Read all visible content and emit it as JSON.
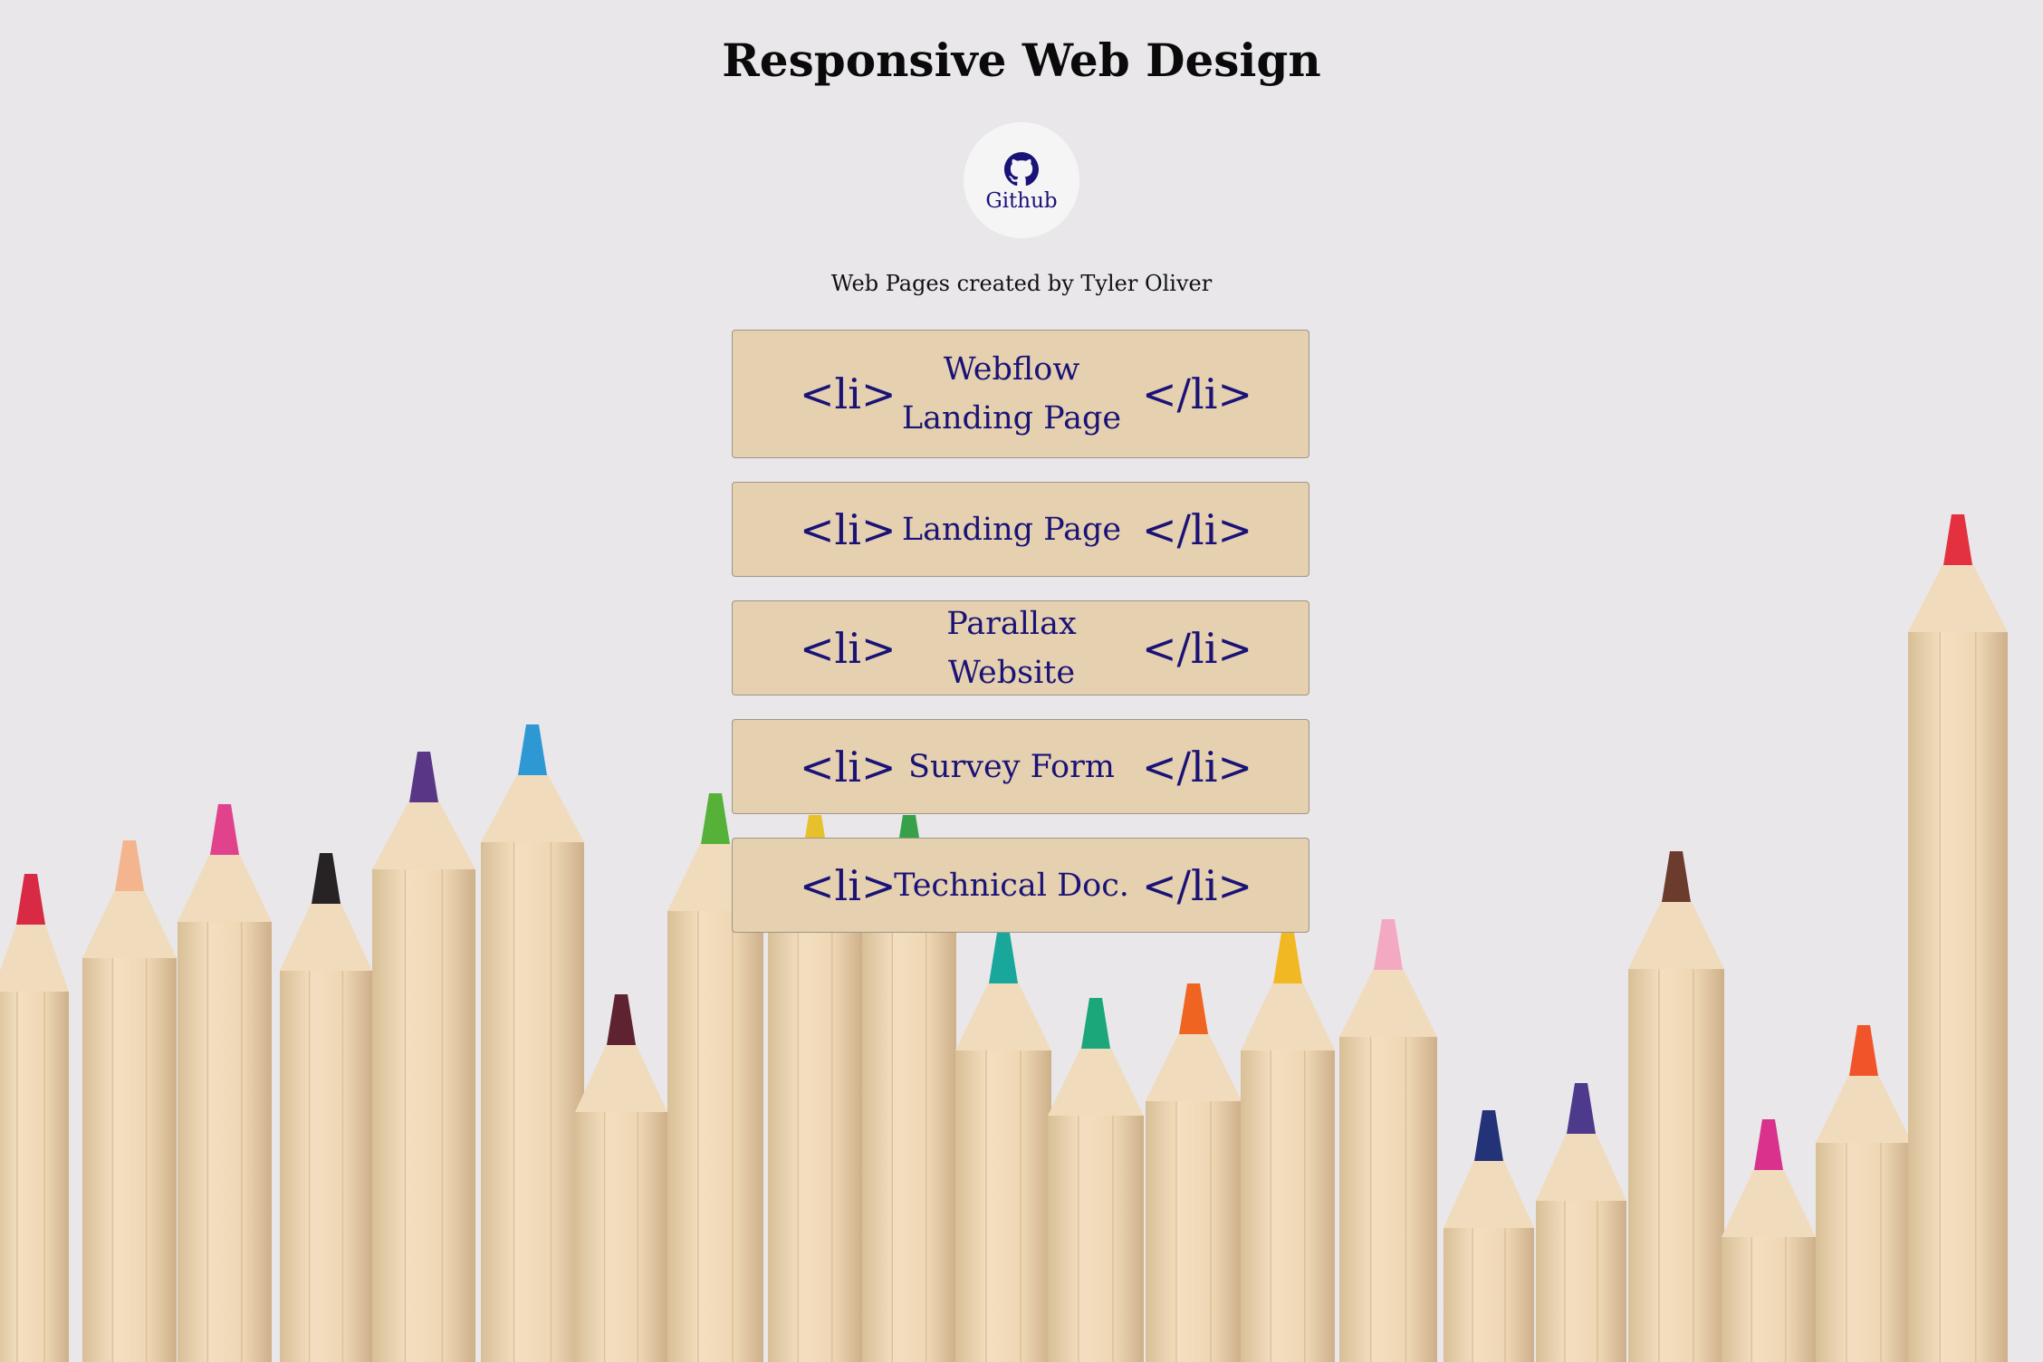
{
  "page": {
    "title": "Responsive Web Design",
    "credit": "Web Pages created by Tyler Oliver"
  },
  "github": {
    "label": "Github",
    "icon": "github-icon"
  },
  "tags": {
    "open": "<li>",
    "close": "</li>"
  },
  "projects": [
    {
      "label": "Webflow Landing Page"
    },
    {
      "label": "Landing Page"
    },
    {
      "label": "Parallax Website"
    },
    {
      "label": "Survey Form"
    },
    {
      "label": "Technical Doc."
    }
  ],
  "colors": {
    "background": "#e9e7ea",
    "card": "#e5d0af",
    "link_text": "#1a1377",
    "title_text": "#0a0a0a"
  },
  "background_image": "colored-pencils-photo"
}
